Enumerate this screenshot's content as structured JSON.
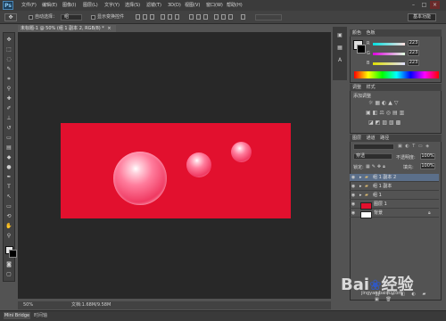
{
  "app": {
    "logo": "Ps"
  },
  "menu": [
    "文件(F)",
    "编辑(E)",
    "图像(I)",
    "图层(L)",
    "文字(Y)",
    "选择(S)",
    "滤镜(T)",
    "3D(D)",
    "视图(V)",
    "窗口(W)",
    "帮助(H)"
  ],
  "window_controls": {
    "minimize": "–",
    "maximize": "□",
    "close": "×"
  },
  "options": {
    "auto_select_label": "自动选择：",
    "auto_select_value": "组",
    "show_transform_label": "显示变换控件",
    "workspace": "基本功能"
  },
  "document": {
    "tab_title": "未标题-1 @ 50% (组 1 副本 2, RGB/8) *",
    "close": "×"
  },
  "status": {
    "zoom": "50%",
    "doc_size": "文档:1.68M/9.58M"
  },
  "bridge": {
    "tab": "Mini Bridge",
    "tab2": "时间轴"
  },
  "color_panel": {
    "tabs": [
      "颜色",
      "色板"
    ],
    "channels": [
      {
        "label": "R",
        "value": "223"
      },
      {
        "label": "G",
        "value": "223"
      },
      {
        "label": "B",
        "value": "223"
      }
    ]
  },
  "adjust_panel": {
    "tabs": [
      "调整",
      "样式"
    ],
    "heading": "添加调整"
  },
  "layers_panel": {
    "tabs": [
      "图层",
      "通道",
      "路径"
    ],
    "blend_mode": "穿透",
    "opacity_label": "不透明度:",
    "opacity": "100%",
    "lock_label": "锁定:",
    "fill_label": "填充:",
    "fill": "100%",
    "layers": [
      {
        "name": "组 1 副本 2",
        "type": "group",
        "selected": true
      },
      {
        "name": "组 1 副本",
        "type": "group",
        "selected": false
      },
      {
        "name": "组 1",
        "type": "group",
        "selected": false
      },
      {
        "name": "图层 1",
        "type": "layer",
        "selected": false
      },
      {
        "name": "背景",
        "type": "background",
        "selected": false
      }
    ]
  },
  "watermark": {
    "text": "Bai",
    "text2": "经验",
    "sub": "jingyan.baidu.com"
  },
  "colors": {
    "canvas": "#e2102e",
    "workspace": "#282828",
    "panel": "#535353",
    "selected_layer": "#5b6f8a"
  }
}
